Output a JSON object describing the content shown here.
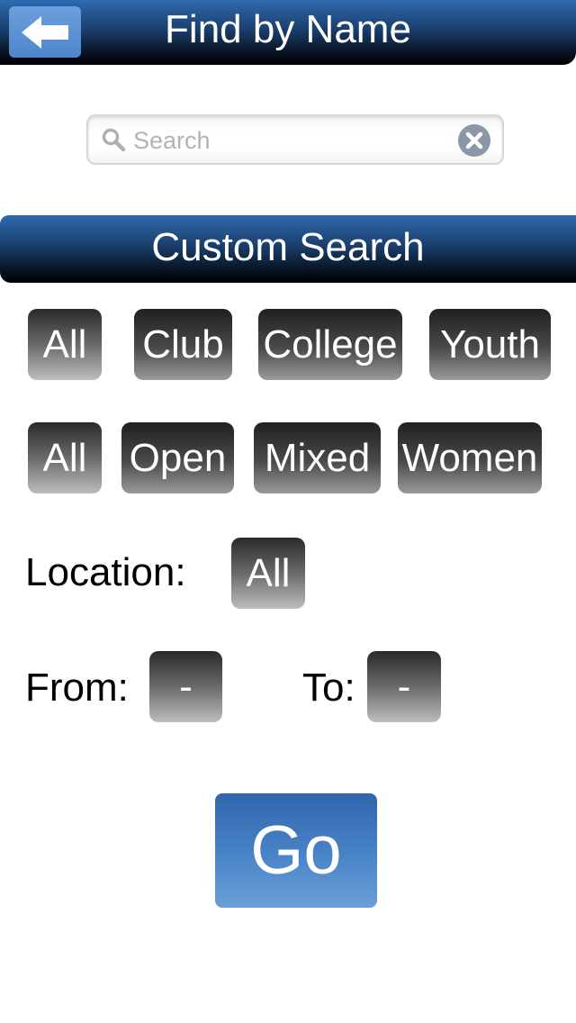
{
  "header": {
    "title": "Find by Name",
    "back_icon": "arrow-left-icon"
  },
  "search": {
    "placeholder": "Search",
    "value": "",
    "search_icon": "magnifier-icon",
    "clear_icon": "clear-circle-icon"
  },
  "custom_search": {
    "title": "Custom Search"
  },
  "division_filters": [
    "All",
    "Club",
    "College",
    "Youth"
  ],
  "gender_filters": [
    "All",
    "Open",
    "Mixed",
    "Women"
  ],
  "location": {
    "label": "Location:",
    "value": "All"
  },
  "date_range": {
    "from_label": "From:",
    "from_value": "-",
    "to_label": "To:",
    "to_value": "-"
  },
  "go_button": {
    "label": "Go"
  },
  "colors": {
    "header_blue": "#2f6ab0",
    "go_blue": "#4a84c8",
    "chip_dark": "#333333"
  }
}
